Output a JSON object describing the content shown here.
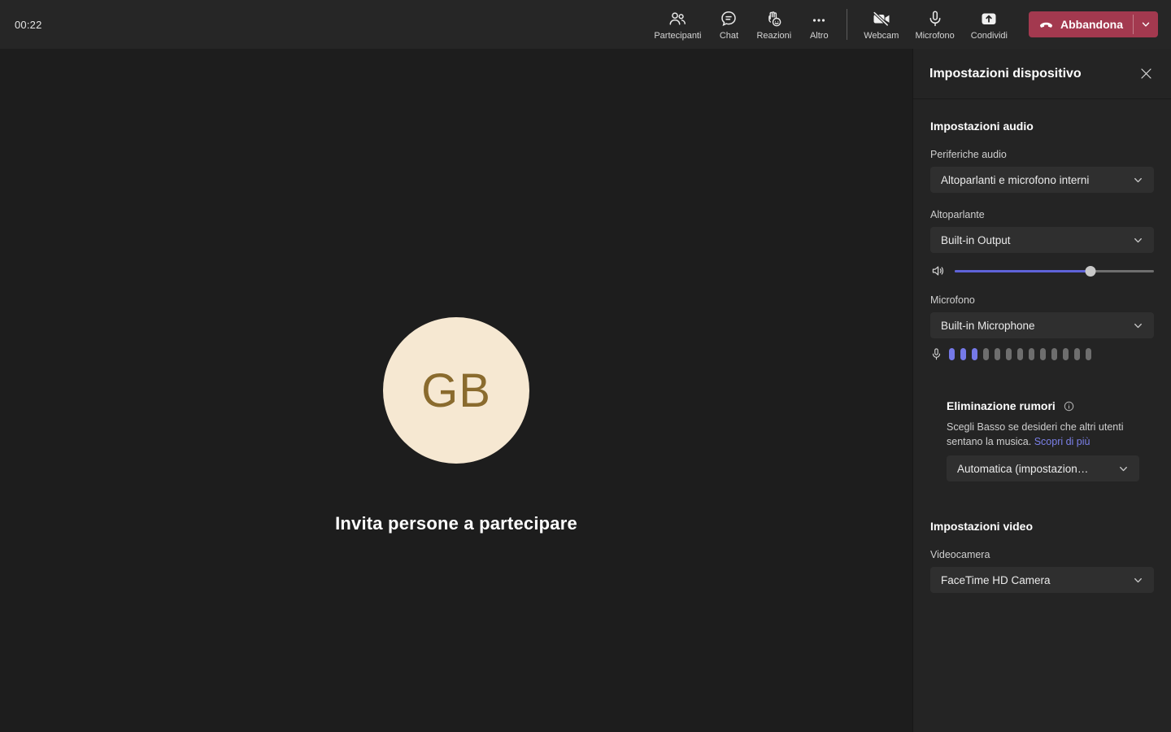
{
  "topbar": {
    "timer": "00:22",
    "buttons": {
      "participants": {
        "label": "Partecipanti"
      },
      "chat": {
        "label": "Chat"
      },
      "reactions": {
        "label": "Reazioni"
      },
      "more": {
        "label": "Altro"
      },
      "webcam": {
        "label": "Webcam"
      },
      "microphone": {
        "label": "Microfono"
      },
      "share": {
        "label": "Condividi"
      }
    },
    "leave": {
      "label": "Abbandona"
    }
  },
  "stage": {
    "avatar_initials": "GB",
    "invite_text": "Invita persone a partecipare"
  },
  "panel": {
    "title": "Impostazioni dispositivo",
    "audio": {
      "heading": "Impostazioni audio",
      "devices_label": "Periferiche audio",
      "devices_value": "Altoparlanti e microfono interni",
      "speaker_label": "Altoparlante",
      "speaker_value": "Built-in Output",
      "volume_percent": 68,
      "mic_label": "Microfono",
      "mic_value": "Built-in Microphone",
      "mic_level": {
        "total": 13,
        "active": 3
      },
      "noise": {
        "heading": "Eliminazione rumori",
        "description": "Scegli Basso se desideri che altri utenti sentano la musica. ",
        "link": "Scopri di più",
        "value": "Automatica (impostazion…"
      }
    },
    "video": {
      "heading": "Impostazioni video",
      "camera_label": "Videocamera",
      "camera_value": "FaceTime HD Camera"
    }
  },
  "colors": {
    "accent": "#7579e8",
    "slider_fill": "#5f63d9",
    "leave_red": "#a3394f",
    "avatar_bg": "#f6e8d2",
    "avatar_text": "#8a6b2e",
    "link": "#7b80e8"
  }
}
